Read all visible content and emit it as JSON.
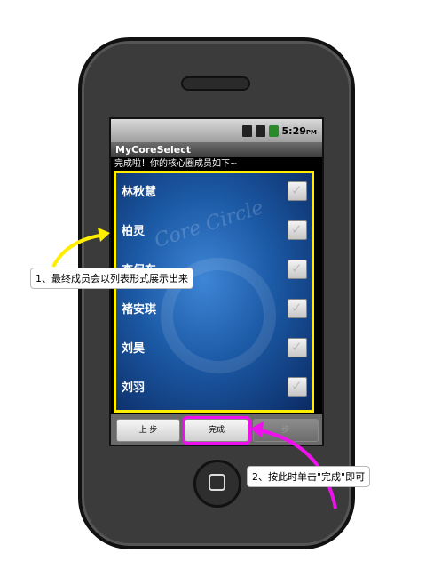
{
  "status_bar": {
    "time": "5:29",
    "ampm": "PM"
  },
  "app": {
    "title": "MyCoreSelect"
  },
  "subtitle": "完成啦！你的核心圈成员如下~",
  "watermark": "Core Circle",
  "members": [
    {
      "name": "林秋慧",
      "checked": true
    },
    {
      "name": "柏灵",
      "checked": true
    },
    {
      "name": "李保东",
      "checked": true
    },
    {
      "name": "褚安琪",
      "checked": true
    },
    {
      "name": "刘昊",
      "checked": true
    },
    {
      "name": "刘羽",
      "checked": true
    }
  ],
  "buttons": {
    "prev": "上 步",
    "finish": "完成",
    "next": "步"
  },
  "annotations": {
    "note1": "1、最终成员会以列表形式展示出来",
    "note2": "2、按此时单击\"完成\"即可"
  },
  "colors": {
    "list_border": "#ffee00",
    "finish_highlight": "#ee11ee"
  }
}
